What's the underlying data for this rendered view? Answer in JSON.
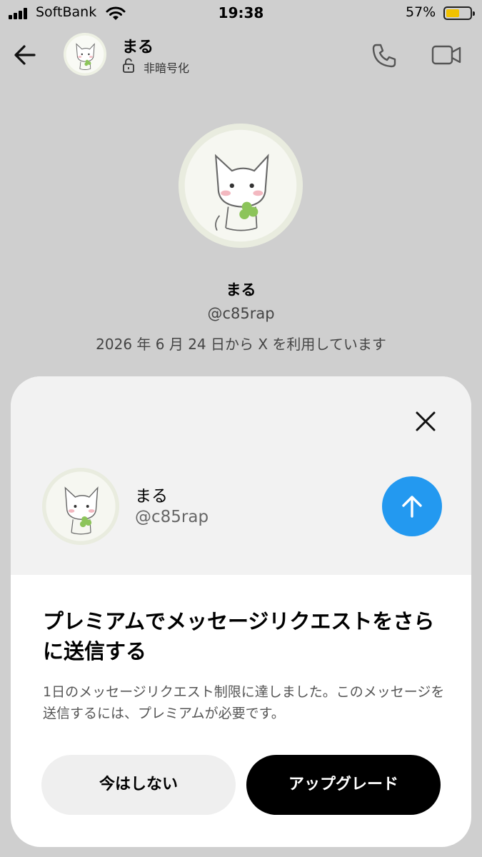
{
  "status_bar": {
    "carrier": "SoftBank",
    "time": "19:38",
    "battery_percent": "57%",
    "battery_level": 0.57,
    "battery_color": "#f2c200"
  },
  "header": {
    "name": "まる",
    "encryption_status": "非暗号化",
    "icons": {
      "back": "arrow-left-icon",
      "lock": "unlocked-lock-icon",
      "call": "phone-icon",
      "video": "video-camera-icon"
    }
  },
  "profile": {
    "name": "まる",
    "handle": "@c85rap",
    "joined": "2026 年 6 月 24 日から X を利用しています"
  },
  "sheet": {
    "recipient": {
      "name": "まる",
      "handle": "@c85rap"
    },
    "headline": "プレミアムでメッセージリクエストをさらに送信する",
    "body": "1日のメッセージリクエスト制限に達しました。このメッセージを送信するには、プレミアムが必要です。",
    "not_now_label": "今はしない",
    "upgrade_label": "アップグレード",
    "icons": {
      "close": "close-icon",
      "send": "arrow-up-icon"
    },
    "colors": {
      "send_button": "#2399f0",
      "upgrade_button": "#000000"
    }
  }
}
